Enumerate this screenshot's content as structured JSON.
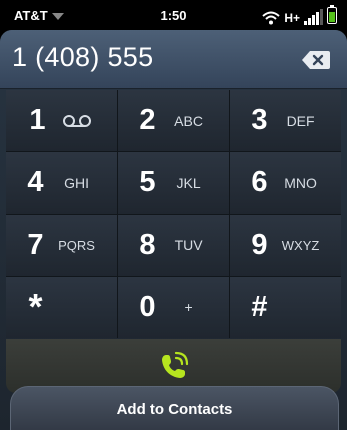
{
  "status_bar": {
    "carrier": "AT&T",
    "time": "1:50",
    "network": "H+",
    "signal_bars": 4,
    "battery_level": 0.8,
    "icons": [
      "wifi-icon",
      "signal-icon",
      "battery-icon"
    ]
  },
  "dialer": {
    "number": "1 (408) 555"
  },
  "keypad": {
    "keys": [
      {
        "digit": "1",
        "letters": "",
        "icon": "voicemail-icon"
      },
      {
        "digit": "2",
        "letters": "ABC"
      },
      {
        "digit": "3",
        "letters": "DEF"
      },
      {
        "digit": "4",
        "letters": "GHI"
      },
      {
        "digit": "5",
        "letters": "JKL"
      },
      {
        "digit": "6",
        "letters": "MNO"
      },
      {
        "digit": "7",
        "letters": "PQRS"
      },
      {
        "digit": "8",
        "letters": "TUV"
      },
      {
        "digit": "9",
        "letters": "WXYZ"
      },
      {
        "digit": "*",
        "letters": ""
      },
      {
        "digit": "0",
        "letters": "+"
      },
      {
        "digit": "#",
        "letters": ""
      }
    ]
  },
  "call_button": {
    "icon": "phone-call-icon",
    "color": "#b6e51f"
  },
  "add_contacts": {
    "label": "Add to Contacts"
  }
}
